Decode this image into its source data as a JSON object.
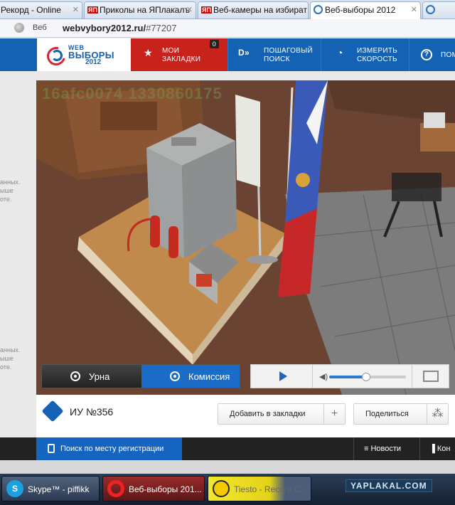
{
  "browser": {
    "tabs": [
      {
        "label": "Рекорд - Online",
        "favicon": "radio-icon",
        "active": false
      },
      {
        "label": "Приколы на ЯПлакалъ",
        "favicon": "yaplakal-icon",
        "active": false
      },
      {
        "label": "Веб-камеры на избират",
        "favicon": "yaplakal-icon",
        "active": false
      },
      {
        "label": "Веб-выборы 2012",
        "favicon": "webvybory-icon",
        "active": true
      },
      {
        "label": "",
        "favicon": "webvybory-icon",
        "active": false
      }
    ],
    "address": {
      "prefix": "Веб",
      "url": "webvybory2012.ru/",
      "hash": "#77207"
    }
  },
  "site": {
    "logo": {
      "line1": "WEB",
      "line2": "ВЫБОРЫ",
      "line3": "2012"
    },
    "nav": {
      "bookmarks": {
        "line1": "МОИ",
        "line2": "ЗАКЛАДКИ",
        "count": "0"
      },
      "step_search": {
        "line1": "ПОШАГОВЫЙ",
        "line2": "ПОИСК"
      },
      "speed": {
        "line1": "ИЗМЕРИТЬ",
        "line2": "СКОРОСТЬ"
      },
      "help": {
        "line1": "ПОМ"
      }
    },
    "side_text_1": [
      "анных.",
      "ыше",
      "оте."
    ],
    "side_text_2": [
      "анных.",
      "ыше",
      "оте."
    ],
    "camera": {
      "stamp": "16afc0074 1330860175"
    },
    "player": {
      "tab_urn": "Урна",
      "tab_commission": "Комиссия",
      "volume_level": 0.48
    },
    "uik": {
      "title": "ИУ №356",
      "add_bookmark": "Добавить в закладки",
      "share": "Поделиться"
    },
    "bottom": {
      "reg_search": "Поиск по месту регистрации",
      "news": "Новости",
      "next": "Кон"
    }
  },
  "taskbar": {
    "items": [
      {
        "label": "Skype™ - piffikk",
        "icon": "skype-icon"
      },
      {
        "label": "Веб-выборы 201...",
        "icon": "opera-icon"
      },
      {
        "label": "Tiesto - Record Cl...",
        "icon": "player-icon"
      }
    ],
    "watermark": "YAPLAKAL.COM"
  },
  "colors": {
    "brand_blue": "#1462b4",
    "bookmark_red": "#c8221c",
    "commission_blue": "#1a6cc6"
  }
}
